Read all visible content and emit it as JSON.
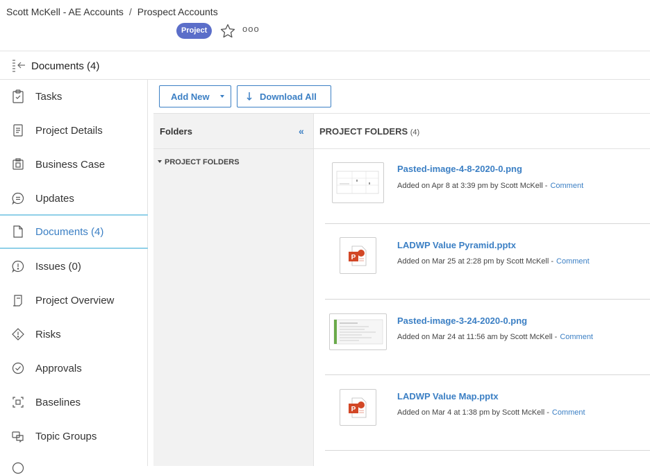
{
  "header": {
    "breadcrumb": [
      "Scott McKell - AE Accounts",
      "Prospect Accounts"
    ],
    "separator": "/",
    "badge": "Project",
    "more": "ooo"
  },
  "titlebar": {
    "title": "Documents (4)"
  },
  "sidebar": {
    "items": [
      {
        "label": "Tasks",
        "icon": "tasks-icon"
      },
      {
        "label": "Project Details",
        "icon": "details-icon"
      },
      {
        "label": "Business Case",
        "icon": "business-case-icon"
      },
      {
        "label": "Updates",
        "icon": "updates-icon"
      },
      {
        "label": "Documents (4)",
        "icon": "document-icon",
        "active": true
      },
      {
        "label": "Issues (0)",
        "icon": "issues-icon"
      },
      {
        "label": "Project Overview",
        "icon": "overview-icon"
      },
      {
        "label": "Risks",
        "icon": "risks-icon"
      },
      {
        "label": "Approvals",
        "icon": "approvals-icon"
      },
      {
        "label": "Baselines",
        "icon": "baselines-icon"
      },
      {
        "label": "Topic Groups",
        "icon": "topic-groups-icon"
      }
    ]
  },
  "toolbar": {
    "add_new": "Add New",
    "download_all": "Download All"
  },
  "folders": {
    "title": "Folders",
    "collapse": "«",
    "tree_item": "PROJECT FOLDERS"
  },
  "main": {
    "title": "PROJECT FOLDERS",
    "count": "(4)",
    "documents": [
      {
        "name": "Pasted-image-4-8-2020-0.png",
        "meta": "Added on Apr 8 at 3:39 pm by Scott McKell -",
        "comment": "Comment",
        "thumb": "image"
      },
      {
        "name": "LADWP Value Pyramid.pptx",
        "meta": "Added on Mar 25 at 2:28 pm by Scott McKell -",
        "comment": "Comment",
        "thumb": "pptx"
      },
      {
        "name": "Pasted-image-3-24-2020-0.png",
        "meta": "Added on Mar 24 at 11:56 am by Scott McKell -",
        "comment": "Comment",
        "thumb": "image"
      },
      {
        "name": "LADWP Value Map.pptx",
        "meta": "Added on Mar 4 at 1:38 pm by Scott McKell -",
        "comment": "Comment",
        "thumb": "pptx"
      }
    ]
  },
  "colors": {
    "accent": "#3b7fc4",
    "badge": "#5b6ec9",
    "active_border": "#8fd0e8",
    "pptx": "#d24726"
  }
}
